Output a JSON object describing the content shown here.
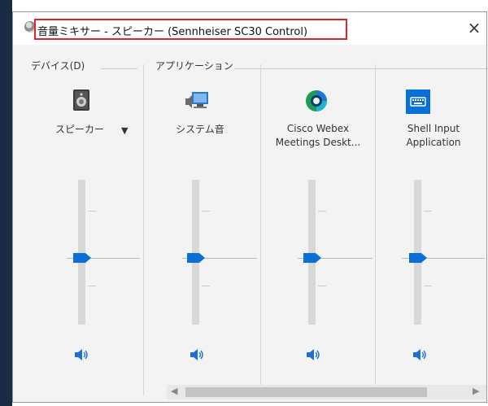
{
  "window": {
    "title": "音量ミキサー - スピーカー (Sennheiser SC30 Control)",
    "close_glyph": "×"
  },
  "sections": {
    "device_label": "デバイス(D)",
    "apps_label": "アプリケーション"
  },
  "device": {
    "name": "スピーカー",
    "icon": "speaker-device-icon",
    "dropdown_glyph": "▼",
    "volume_level": 0.5
  },
  "applications": [
    {
      "name_line1": "システム音",
      "name_line2": "",
      "icon": "system-sounds-icon",
      "volume_level": 0.5
    },
    {
      "name_line1": "Cisco Webex",
      "name_line2": "Meetings Deskt...",
      "icon": "webex-icon",
      "volume_level": 0.5
    },
    {
      "name_line1": "Shell Input",
      "name_line2": "Application",
      "icon": "keyboard-app-icon",
      "volume_level": 0.5
    }
  ],
  "colors": {
    "accent": "#0a6fd6",
    "highlight_box": "#e0262b",
    "window_bg": "#f3f3f3"
  },
  "scrollbar": {
    "left_arrow": "◀",
    "right_arrow": "▶"
  }
}
